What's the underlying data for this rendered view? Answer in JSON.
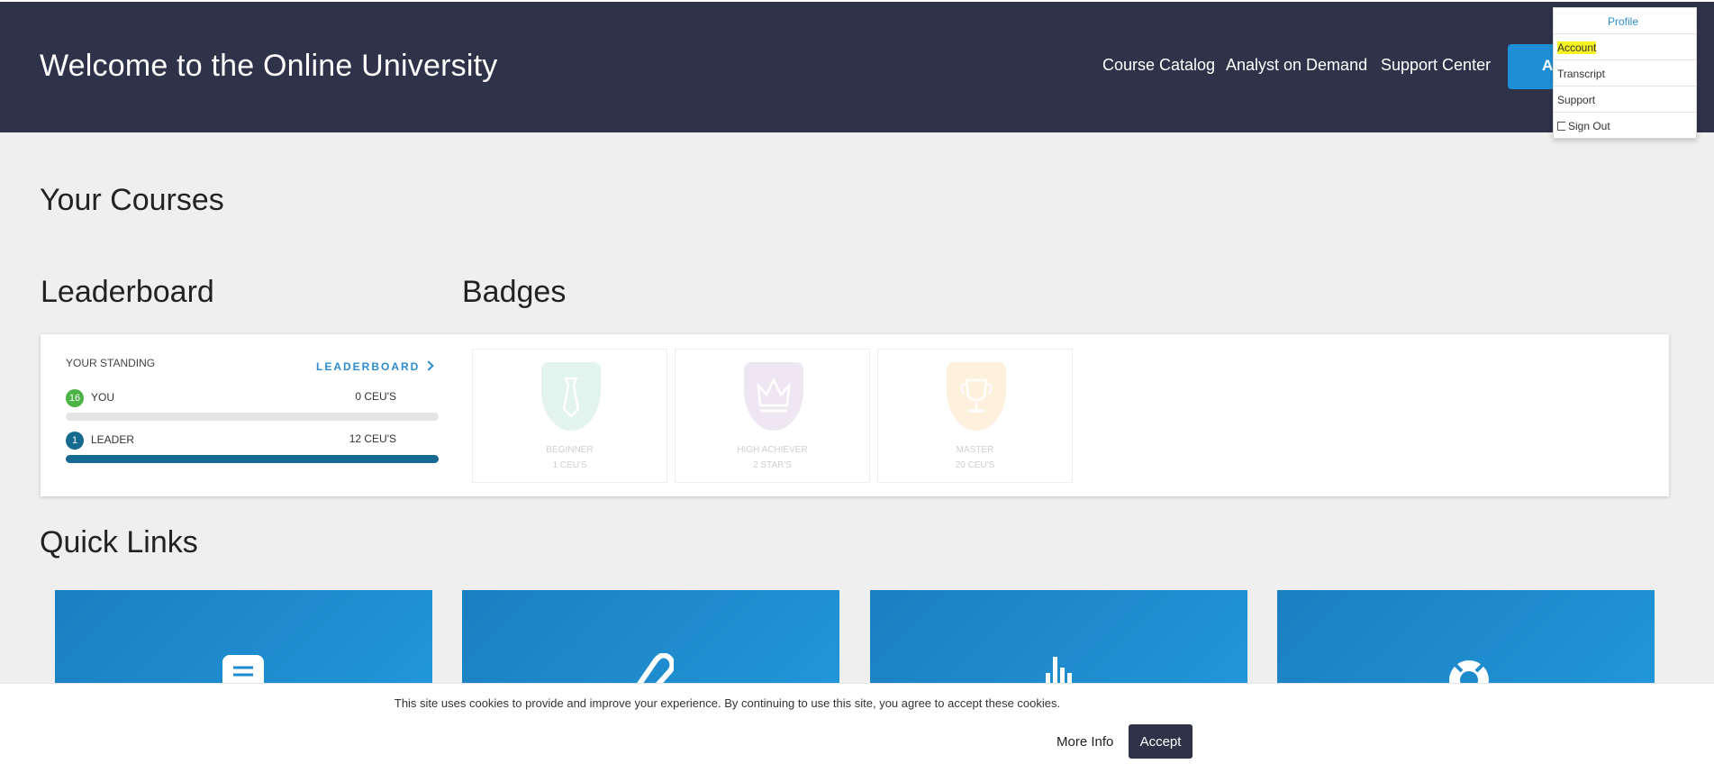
{
  "header": {
    "title": "Welcome to the Online University",
    "nav": [
      "Course Catalog",
      "Analyst on Demand",
      "Support Center"
    ],
    "account_button": "A"
  },
  "dropdown": {
    "header": "Profile",
    "items": [
      "Account",
      "Transcript",
      "Support",
      "Sign Out"
    ],
    "highlight_color": "#f7f222"
  },
  "sections": {
    "courses": "Your Courses",
    "leaderboard": "Leaderboard",
    "badges": "Badges",
    "quick_links": "Quick Links"
  },
  "standing": {
    "label": "YOUR STANDING",
    "link": "LEADERBOARD",
    "you": {
      "rank": "16",
      "name": "YOU",
      "value": "0 CEU'S",
      "progress": 0
    },
    "leader": {
      "rank": "1",
      "name": "LEADER",
      "value": "12 CEU'S",
      "progress": 1
    }
  },
  "badges": [
    {
      "name": "BEGINNER",
      "requirement": "1 CEU'S",
      "icon": "tie-icon",
      "color": "#e3f3ee"
    },
    {
      "name": "HIGH ACHIEVER",
      "requirement": "2 STAR'S",
      "icon": "crown-icon",
      "color": "#eee6f2"
    },
    {
      "name": "MASTER",
      "requirement": "20 CEU'S",
      "icon": "trophy-icon",
      "color": "#fdf0dc"
    }
  ],
  "quick_links": [
    {
      "icon": "document-icon"
    },
    {
      "icon": "paperclip-icon"
    },
    {
      "icon": "chart-icon"
    },
    {
      "icon": "lifebuoy-icon"
    }
  ],
  "cookie": {
    "text": "This site uses cookies to provide and improve your experience. By continuing to use this site, you agree to accept these cookies.",
    "more_info": "More Info",
    "accept": "Accept"
  }
}
